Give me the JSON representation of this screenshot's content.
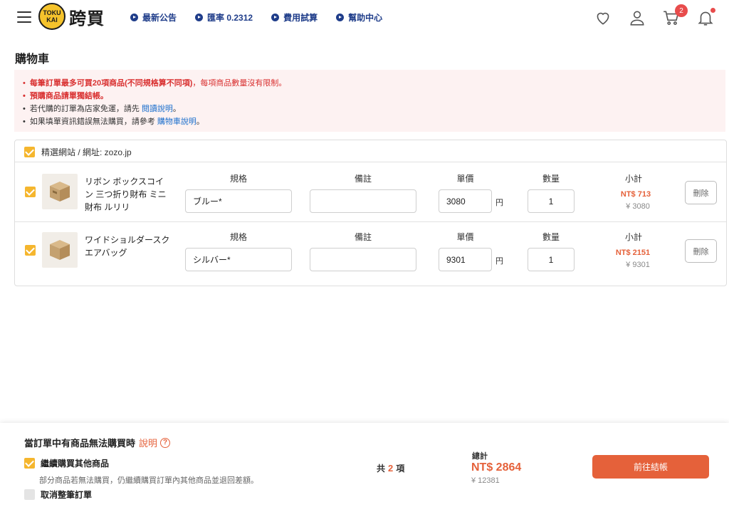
{
  "header": {
    "logo_small_top": "TOKU",
    "logo_small_bottom": "KAI",
    "logo_text": "跨買",
    "nav": [
      {
        "label": "最新公告"
      },
      {
        "label": "匯率 0.2312"
      },
      {
        "label": "費用試算"
      },
      {
        "label": "幫助中心"
      }
    ],
    "cart_badge": "2"
  },
  "page": {
    "title": "購物車"
  },
  "notice": {
    "line1_strong": "每筆訂單最多可買20項商品(不同規格算不同項)",
    "line1_rest": "，每項商品數量沒有限制。",
    "line2": "預購商品請單獨結帳。",
    "line3_pre": "若代購的訂單為店家免運，請先",
    "line3_link": "閱讀說明",
    "line3_post": "。",
    "line4_pre": "如果填單資訊錯誤無法購買，請參考",
    "line4_link": "購物車說明",
    "line4_post": "。"
  },
  "cart": {
    "shop_label": "精選網站 / 網址: zozo.jp",
    "columns": {
      "spec": "規格",
      "note": "備註",
      "price": "單價",
      "qty": "數量",
      "subtotal": "小計"
    },
    "yen_unit": "円",
    "delete_label": "刪除",
    "items": [
      {
        "name": "リボン ボックスコイン 三つ折り財布 ミニ財布 ルリリ",
        "spec": "ブルー*",
        "note": "",
        "price": "3080",
        "qty": "1",
        "subtotal_nt": "NT$ 713",
        "subtotal_jp": "¥ 3080"
      },
      {
        "name": "ワイドショルダースクエアバッグ",
        "spec": "シルバー*",
        "note": "",
        "price": "9301",
        "qty": "1",
        "subtotal_nt": "NT$ 2151",
        "subtotal_jp": "¥ 9301"
      }
    ]
  },
  "bottom": {
    "title": "當訂單中有商品無法購買時",
    "help_link": "說明",
    "help_icon": "?",
    "option1": "繼續購買其他商品",
    "option1_desc": "部分商品若無法購買，仍繼續購買訂單內其他商品並退回差額。",
    "option2": "取消整筆訂單",
    "count_pre": "共",
    "count_num": "2",
    "count_post": "項",
    "total_label": "總計",
    "total_nt": "NT$ 2864",
    "total_jp": "¥ 12381",
    "checkout_label": "前往結帳"
  },
  "colors": {
    "accent": "#e5613a",
    "nav_blue": "#1f3d8a",
    "checkbox": "#f5b62e",
    "notice_bg": "#fdf2f2"
  }
}
